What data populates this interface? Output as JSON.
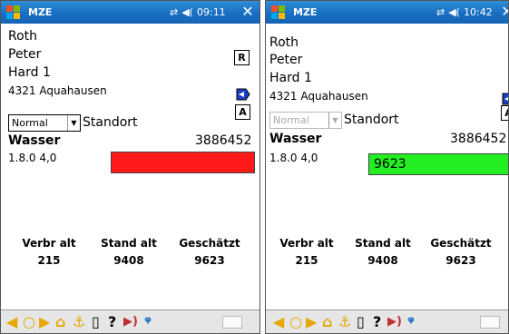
{
  "left": {
    "title": "MZE",
    "time": "09:11",
    "lastname": "Roth",
    "firstname": "Peter",
    "street": "Hard 1",
    "city": "4321 Aquahausen",
    "btn_r": "R",
    "btn_a": "A",
    "mode": "Normal",
    "standort": "Standort",
    "medium": "Wasser",
    "meter_number": "3886452",
    "register": "1.8.0 4,0",
    "reading": "",
    "stats": [
      {
        "label": "Verbr alt",
        "value": "215"
      },
      {
        "label": "Stand alt",
        "value": "9408"
      },
      {
        "label": "Geschätzt",
        "value": "9623"
      }
    ]
  },
  "right": {
    "title": "MZE",
    "time": "10:42",
    "lastname": "Roth",
    "firstname": "Peter",
    "street": "Hard 1",
    "city": "4321 Aquahausen",
    "btn_a": "A",
    "mode": "Normal",
    "standort": "Standort",
    "medium": "Wasser",
    "meter_number": "3886452",
    "register": "1.8.0 4,0",
    "reading": "9623",
    "stats": [
      {
        "label": "Verbr alt",
        "value": "215"
      },
      {
        "label": "Stand alt",
        "value": "9408"
      },
      {
        "label": "Geschätzt",
        "value": "9623"
      }
    ]
  },
  "colors": {
    "titlebar": "#1a6fc2",
    "reading_invalid": "#ff1a1a",
    "reading_valid": "#22ee22",
    "toolbar_icon": "#e6a800"
  },
  "toolbar_icons": [
    "prev-icon",
    "circle-icon",
    "next-icon",
    "home-icon",
    "anchor-icon",
    "document-icon",
    "help-icon",
    "signal-icon",
    "search-tool-icon"
  ]
}
